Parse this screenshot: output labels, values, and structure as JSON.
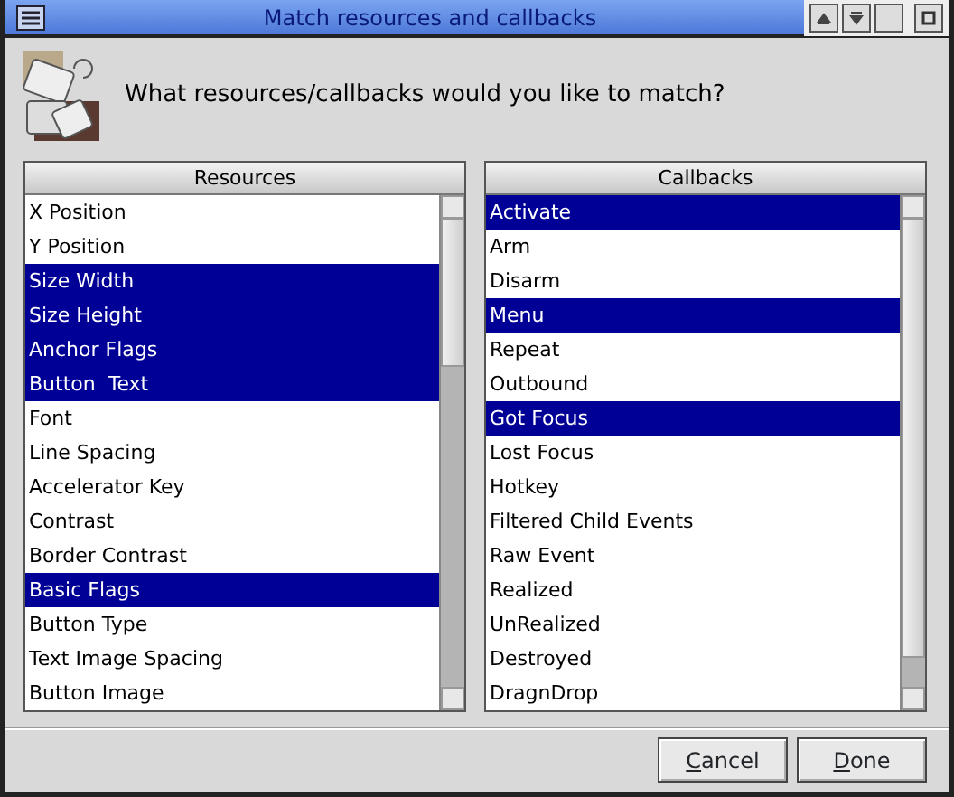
{
  "window": {
    "title": "Match resources and callbacks"
  },
  "prompt": "What resources/callbacks would you like to match?",
  "lists": [
    {
      "heading": "Resources",
      "items": [
        {
          "label": "X Position",
          "selected": false
        },
        {
          "label": "Y Position",
          "selected": false
        },
        {
          "label": "Size Width",
          "selected": true
        },
        {
          "label": "Size Height",
          "selected": true
        },
        {
          "label": "Anchor Flags",
          "selected": true
        },
        {
          "label": "Button  Text",
          "selected": true
        },
        {
          "label": "Font",
          "selected": false
        },
        {
          "label": "Line Spacing",
          "selected": false
        },
        {
          "label": "Accelerator Key",
          "selected": false
        },
        {
          "label": "Contrast",
          "selected": false
        },
        {
          "label": "Border Contrast",
          "selected": false
        },
        {
          "label": "Basic Flags",
          "selected": true
        },
        {
          "label": "Button Type",
          "selected": false
        },
        {
          "label": "Text Image Spacing",
          "selected": false
        },
        {
          "label": "Button Image",
          "selected": false
        }
      ]
    },
    {
      "heading": "Callbacks",
      "items": [
        {
          "label": "Activate",
          "selected": true
        },
        {
          "label": "Arm",
          "selected": false
        },
        {
          "label": "Disarm",
          "selected": false
        },
        {
          "label": "Menu",
          "selected": true
        },
        {
          "label": "Repeat",
          "selected": false
        },
        {
          "label": "Outbound",
          "selected": false
        },
        {
          "label": "Got Focus",
          "selected": true
        },
        {
          "label": "Lost Focus",
          "selected": false
        },
        {
          "label": "Hotkey",
          "selected": false
        },
        {
          "label": "Filtered Child Events",
          "selected": false
        },
        {
          "label": "Raw Event",
          "selected": false
        },
        {
          "label": "Realized",
          "selected": false
        },
        {
          "label": "UnRealized",
          "selected": false
        },
        {
          "label": "Destroyed",
          "selected": false
        },
        {
          "label": "DragnDrop",
          "selected": false
        }
      ]
    }
  ],
  "buttons": [
    "Cancel",
    "Done"
  ]
}
